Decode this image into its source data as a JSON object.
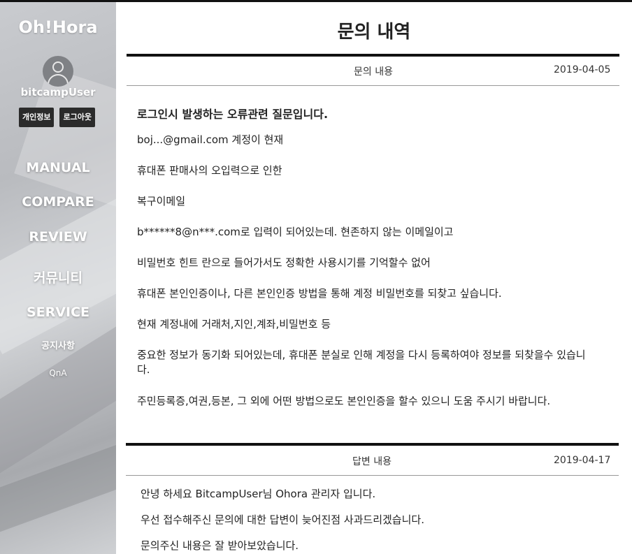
{
  "sidebar": {
    "brand": "Oh!Hora",
    "username": "bitcampUser",
    "buttons": [
      "개인정보",
      "로그아웃"
    ],
    "nav": [
      "MANUAL",
      "COMPARE",
      "REVIEW",
      "커뮤니티",
      "SERVICE"
    ],
    "sub": [
      "공지사항",
      "QnA"
    ]
  },
  "main": {
    "title": "문의 내역",
    "question": {
      "label": "문의 내용",
      "date": "2019-04-05",
      "title": "로그인시 발생하는 오류관련 질문입니다.",
      "paragraphs": [
        "boj...@gmail.com 계정이 현재",
        "휴대폰 판매사의 오입력으로 인한",
        "복구이메일",
        "b******8@n***.com로 입력이 되어있는데. 현존하지 않는 이메일이고",
        "비밀번호 힌트 란으로 들어가서도 정확한 사용시기를 기억할수 없어",
        "휴대폰 본인인증이나, 다른 본인인증 방법을 통해 계정 비밀번호를 되찾고 싶습니다.",
        "현재 계정내에 거래처,지인,계좌,비밀번호 등",
        "중요한 정보가 동기화 되어있는데, 휴대폰 분실로 인해 계정을 다시 등록하여야 정보를 되찾을수 있습니다.",
        "주민등록증,여권,등본, 그 외에 어떤 방법으로도 본인인증을 할수 있으니 도움 주시기 바랍니다."
      ]
    },
    "answer": {
      "label": "답변 내용",
      "date": "2019-04-17",
      "paragraphs": [
        "안녕 하세요 BitcampUser님  Ohora 관리자 입니다.",
        "우선 접수해주신 문의에 대한 답변이 늦어진점 사과드리겠습니다.",
        "문의주신 내용은 잘 받아보았습니다."
      ]
    }
  }
}
